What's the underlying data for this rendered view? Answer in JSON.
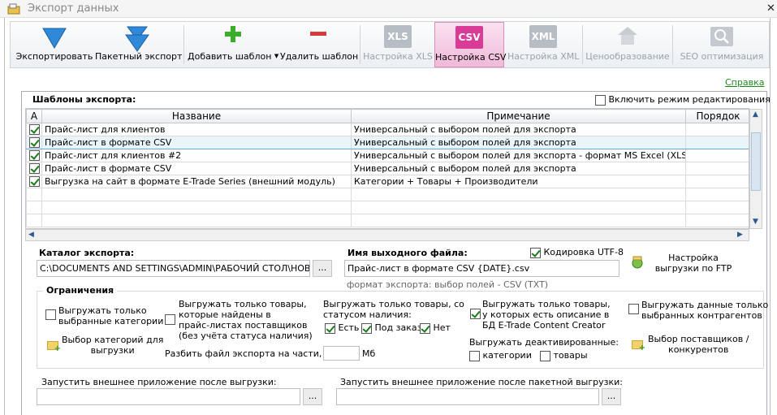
{
  "window": {
    "title": "Экспорт данных"
  },
  "toolbar": {
    "export": "Экспортировать",
    "batch_export": "Пакетный экспорт",
    "add_template": "Добавить шаблон",
    "delete_template": "Удалить шаблон",
    "xls_settings": "Настройка XLS",
    "csv_settings": "Настройка CSV",
    "xml_settings": "Настройка XML",
    "pricing": "Ценообразование",
    "seo": "SEO оптимизация",
    "xls_icon": "XLS",
    "csv_icon": "CSV",
    "xml_icon": "XML"
  },
  "help": "Справка",
  "templates": {
    "title": "Шаблоны экспорта:",
    "edit_mode": "Включить режим редактирования",
    "columns": {
      "active": "А",
      "name": "Название",
      "note": "Примечание",
      "order": "Порядок"
    },
    "rows": [
      {
        "name": "Прайс-лист для клиентов",
        "note": "Универсальный с выбором полей для экспорта"
      },
      {
        "name": "Прайс-лист в формате CSV",
        "note": "Универсальный с выбором полей для экспорта"
      },
      {
        "name": "Прайс-лист для клиентов #2",
        "note": "Универсальный с выбором полей для экспорта - формат MS Excel (XLS)"
      },
      {
        "name": "Прайс-лист в формате CSV",
        "note": "Универсальный с выбором полей для экспорта"
      },
      {
        "name": "Выгрузка на сайт в формате E-Trade Series (внешний модуль)",
        "note": "Категории + Товары + Производители"
      }
    ]
  },
  "catalog": {
    "label": "Каталог экспорта:",
    "value": "C:\\DOCUMENTS AND SETTINGS\\ADMIN\\РАБОЧИЙ СТОЛ\\НОВАЯ ПАГ",
    "browse": "..."
  },
  "output": {
    "label": "Имя выходного файла:",
    "utf8": "Кодировка UTF-8",
    "value": "Прайс-лист в формате CSV {DATE}.csv",
    "format_hint": "формат экспорта: выбор полей - CSV (TXT)"
  },
  "ftp": {
    "line1": "Настройка",
    "line2": "выгрузки по FTP"
  },
  "limits": {
    "title": "Ограничения",
    "selected_categories": [
      "Выгружать только",
      "выбранные категории"
    ],
    "choose_categories": [
      "Выбор категорий для",
      "выгрузки"
    ],
    "found_in_supplier": [
      "Выгружать только товары,",
      "которые найдены в",
      "прайс-листах поставщиков",
      "(без учёта статуса наличия)"
    ],
    "split": "Разбить файл экспорта на части, по:",
    "split_unit": "Мб",
    "availability": [
      "Выгружать только товары, со",
      "статусом наличия:"
    ],
    "avail_yes": "Есть",
    "avail_order": "Под заказ",
    "avail_no": "Нет",
    "with_description": [
      "Выгружать только товары,",
      "у которых есть описание в",
      "БД E-Trade Content Creator"
    ],
    "deactivated": "Выгружать деактивированные:",
    "deact_categories": "категории",
    "deact_goods": "товары",
    "contractors": [
      "Выгружать данные только",
      "выбранных контрагентов"
    ],
    "choose_suppliers": [
      "Выбор поставщиков /",
      "конкурентов"
    ]
  },
  "run_after": {
    "single": "Запустить внешнее приложение после выгрузки:",
    "batch": "Запустить внешнее приложение после пакетной выгрузки:",
    "browse": "..."
  }
}
